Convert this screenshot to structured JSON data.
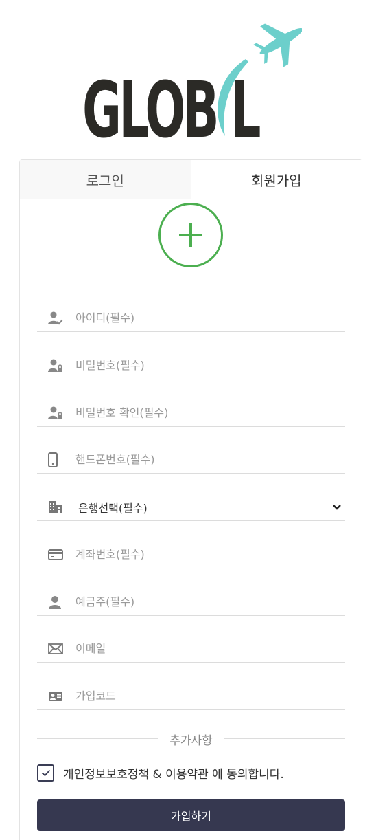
{
  "logo": {
    "text": "GLOB L"
  },
  "tabs": [
    {
      "label": "로그인",
      "active": false
    },
    {
      "label": "회원가입",
      "active": true
    }
  ],
  "form": {
    "fields": [
      {
        "icon": "user-check-icon",
        "placeholder": "아이디(필수)",
        "value": ""
      },
      {
        "icon": "user-lock-icon",
        "placeholder": "비밀번호(필수)",
        "value": ""
      },
      {
        "icon": "user-lock-icon",
        "placeholder": "비밀번호 확인(필수)",
        "value": ""
      },
      {
        "icon": "mobile-phone-icon",
        "placeholder": "핸드폰번호(필수)",
        "value": ""
      }
    ],
    "bank_select": {
      "icon": "building-icon",
      "selected": "은행선택(필수)"
    },
    "fields2": [
      {
        "icon": "credit-card-icon",
        "placeholder": "계좌번호(필수)",
        "value": ""
      },
      {
        "icon": "user-icon",
        "placeholder": "예금주(필수)",
        "value": ""
      },
      {
        "icon": "envelope-icon",
        "placeholder": "이메일",
        "value": ""
      },
      {
        "icon": "id-card-icon",
        "placeholder": "가입코드",
        "value": ""
      }
    ],
    "section_label": "추가사항",
    "agree_text": "개인정보보호정책 & 이용약관 에 동의합니다.",
    "agree_checked": true,
    "submit_label": "가입하기"
  },
  "colors": {
    "accent_green": "#4caf50",
    "button_dark": "#363850",
    "logo_teal": "#6ccfcb",
    "logo_dark": "#2b2a26"
  }
}
